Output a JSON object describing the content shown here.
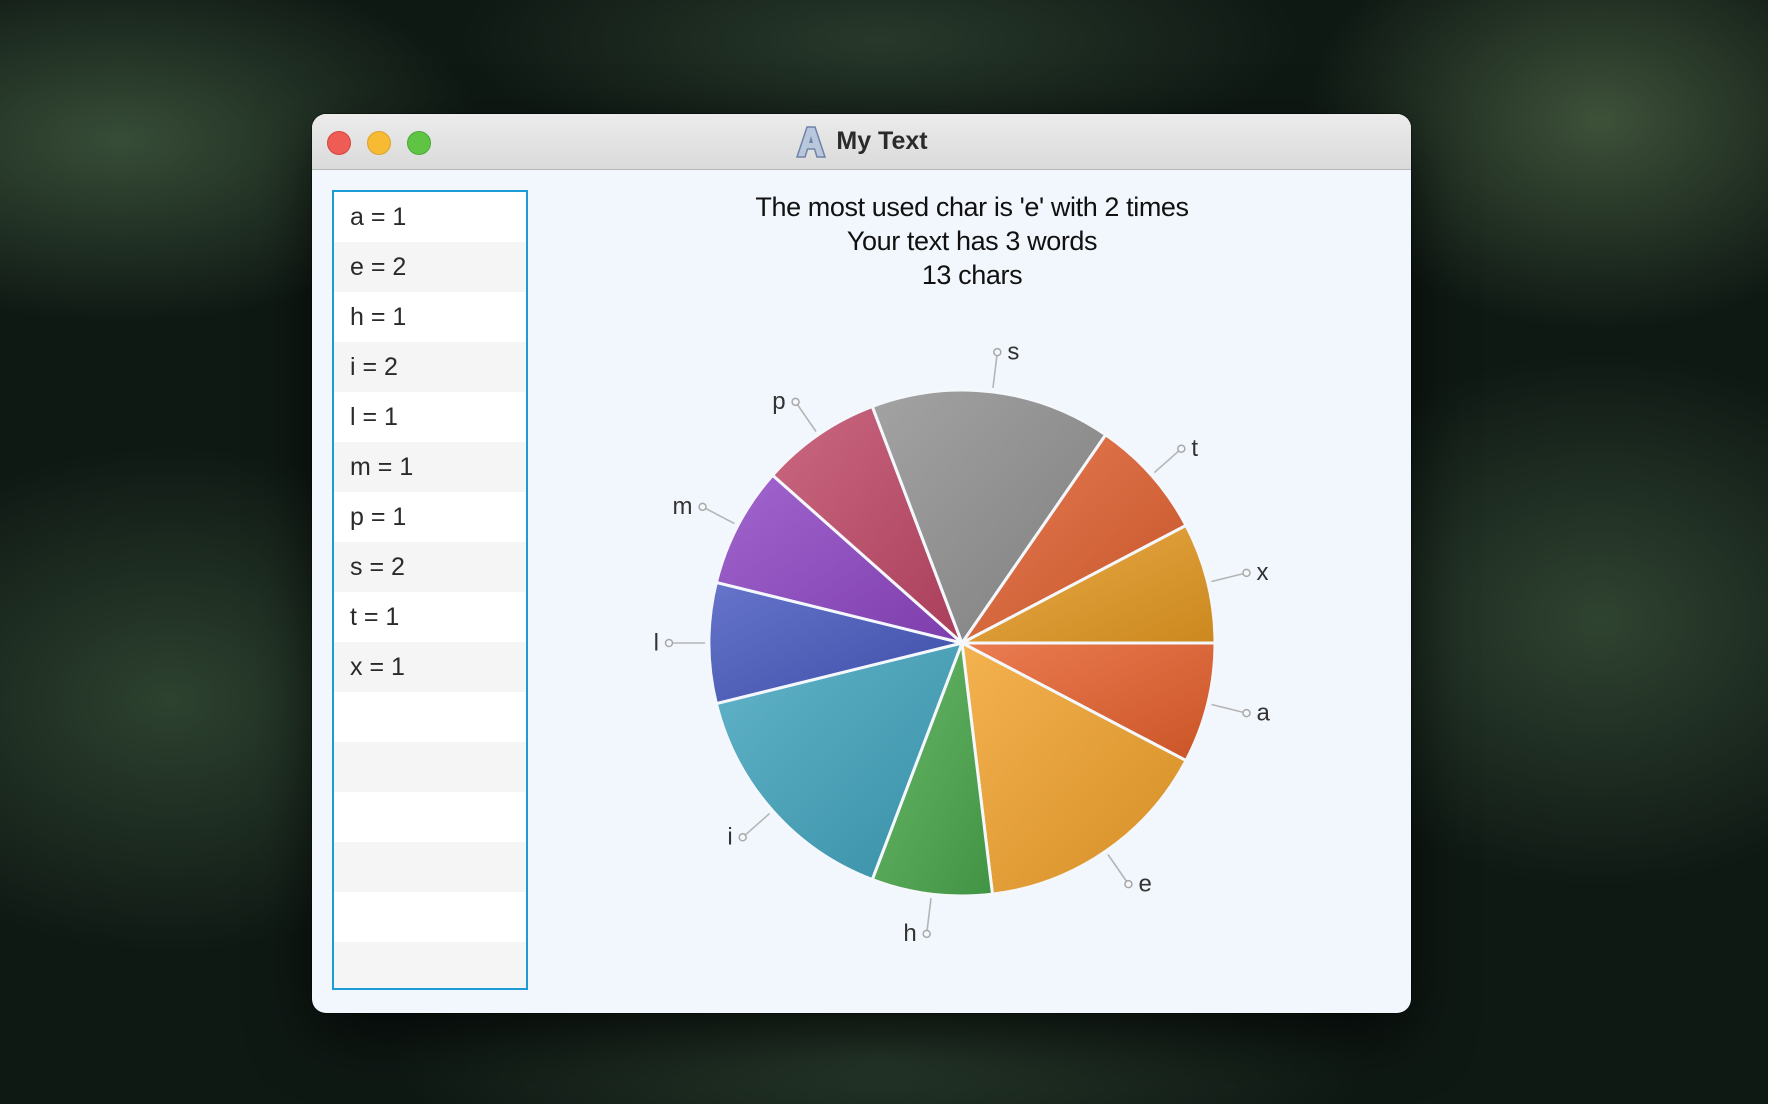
{
  "window": {
    "title": "My Text",
    "icon": "app-letter-a-icon"
  },
  "list": {
    "items": [
      "a = 1",
      "e = 2",
      "h = 1",
      "i = 2",
      "l = 1",
      "m = 1",
      "p = 1",
      "s = 2",
      "t = 1",
      "x = 1"
    ]
  },
  "header": {
    "line1": "The most used char is 'e' with 2 times",
    "line2": "Your text has 3 words",
    "line3": "13 chars"
  },
  "chart_data": {
    "type": "pie",
    "title": "",
    "start_angle_deg": 0,
    "direction": "clockwise",
    "slices": [
      {
        "label": "a",
        "value": 1,
        "color": "#e65f2b"
      },
      {
        "label": "e",
        "value": 2,
        "color": "#f2a12a"
      },
      {
        "label": "h",
        "value": 1,
        "color": "#4aa84c"
      },
      {
        "label": "i",
        "value": 2,
        "color": "#3fa3bd"
      },
      {
        "label": "l",
        "value": 1,
        "color": "#4457be"
      },
      {
        "label": "m",
        "value": 1,
        "color": "#8e45c4"
      },
      {
        "label": "p",
        "value": 1,
        "color": "#c04766"
      },
      {
        "label": "s",
        "value": 2,
        "color": "#8f8f8f"
      },
      {
        "label": "t",
        "value": 1,
        "color": "#e15f2f"
      },
      {
        "label": "x",
        "value": 1,
        "color": "#e79a22"
      }
    ]
  }
}
